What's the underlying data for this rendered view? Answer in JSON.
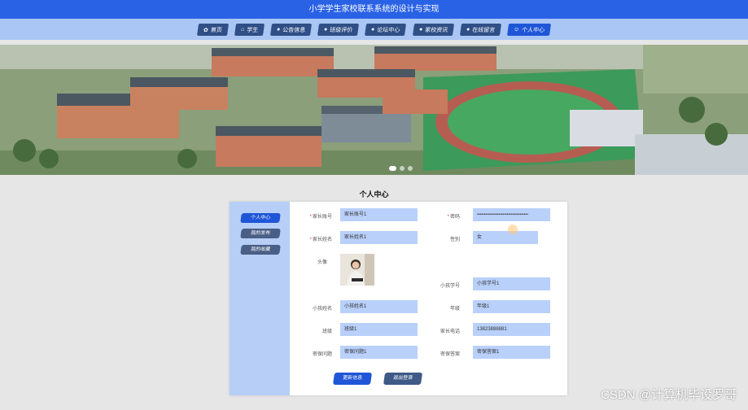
{
  "app": {
    "title": "小学学生家校联系系统的设计与实现"
  },
  "nav": [
    {
      "label": "首页",
      "icon": "home-icon",
      "glyph": "✿"
    },
    {
      "label": "学生",
      "icon": "student-icon",
      "glyph": "⌂"
    },
    {
      "label": "公告信息",
      "icon": "notice-icon",
      "glyph": "●"
    },
    {
      "label": "班级评价",
      "icon": "comment-icon",
      "glyph": "●"
    },
    {
      "label": "论坛中心",
      "icon": "forum-icon",
      "glyph": "●"
    },
    {
      "label": "家校资讯",
      "icon": "news-icon",
      "glyph": "●"
    },
    {
      "label": "在线留言",
      "icon": "message-icon",
      "glyph": "●"
    },
    {
      "label": "个人中心",
      "icon": "user-icon",
      "glyph": "☺"
    }
  ],
  "banner": {
    "active_slide": 1,
    "slide_count": 3
  },
  "page": {
    "title": "个人中心"
  },
  "sidebar": [
    {
      "label": "个人中心"
    },
    {
      "label": "我的发布"
    },
    {
      "label": "我的收藏"
    }
  ],
  "form": {
    "account": {
      "label": "家长账号",
      "value": "家长账号1",
      "required": "*"
    },
    "password": {
      "label": "密码",
      "value": "••••••••••••••••••••••••••••••••••••",
      "required": "*"
    },
    "name": {
      "label": "家长姓名",
      "value": "家长姓名1",
      "required": "*"
    },
    "gender": {
      "label": "性别",
      "value": "女"
    },
    "avatar": {
      "label": "头像"
    },
    "student_no": {
      "label": "小孩学号",
      "value": "小孩学号1"
    },
    "child_name": {
      "label": "小孩姓名",
      "value": "小孩姓名1"
    },
    "grade": {
      "label": "年级",
      "value": "年级1"
    },
    "class": {
      "label": "班级",
      "value": "班级1"
    },
    "phone": {
      "label": "家长电话",
      "value": "13823888881"
    },
    "sec_question": {
      "label": "密保问题",
      "value": "密保问题1"
    },
    "sec_answer": {
      "label": "密保答案",
      "value": "密保答案1"
    }
  },
  "actions": {
    "update": {
      "label": "更新信息",
      "color": "#1f56d8"
    },
    "logout": {
      "label": "退出登录",
      "color": "#3f5a86"
    }
  },
  "watermark": "CSDN @计算机毕设罗哥"
}
